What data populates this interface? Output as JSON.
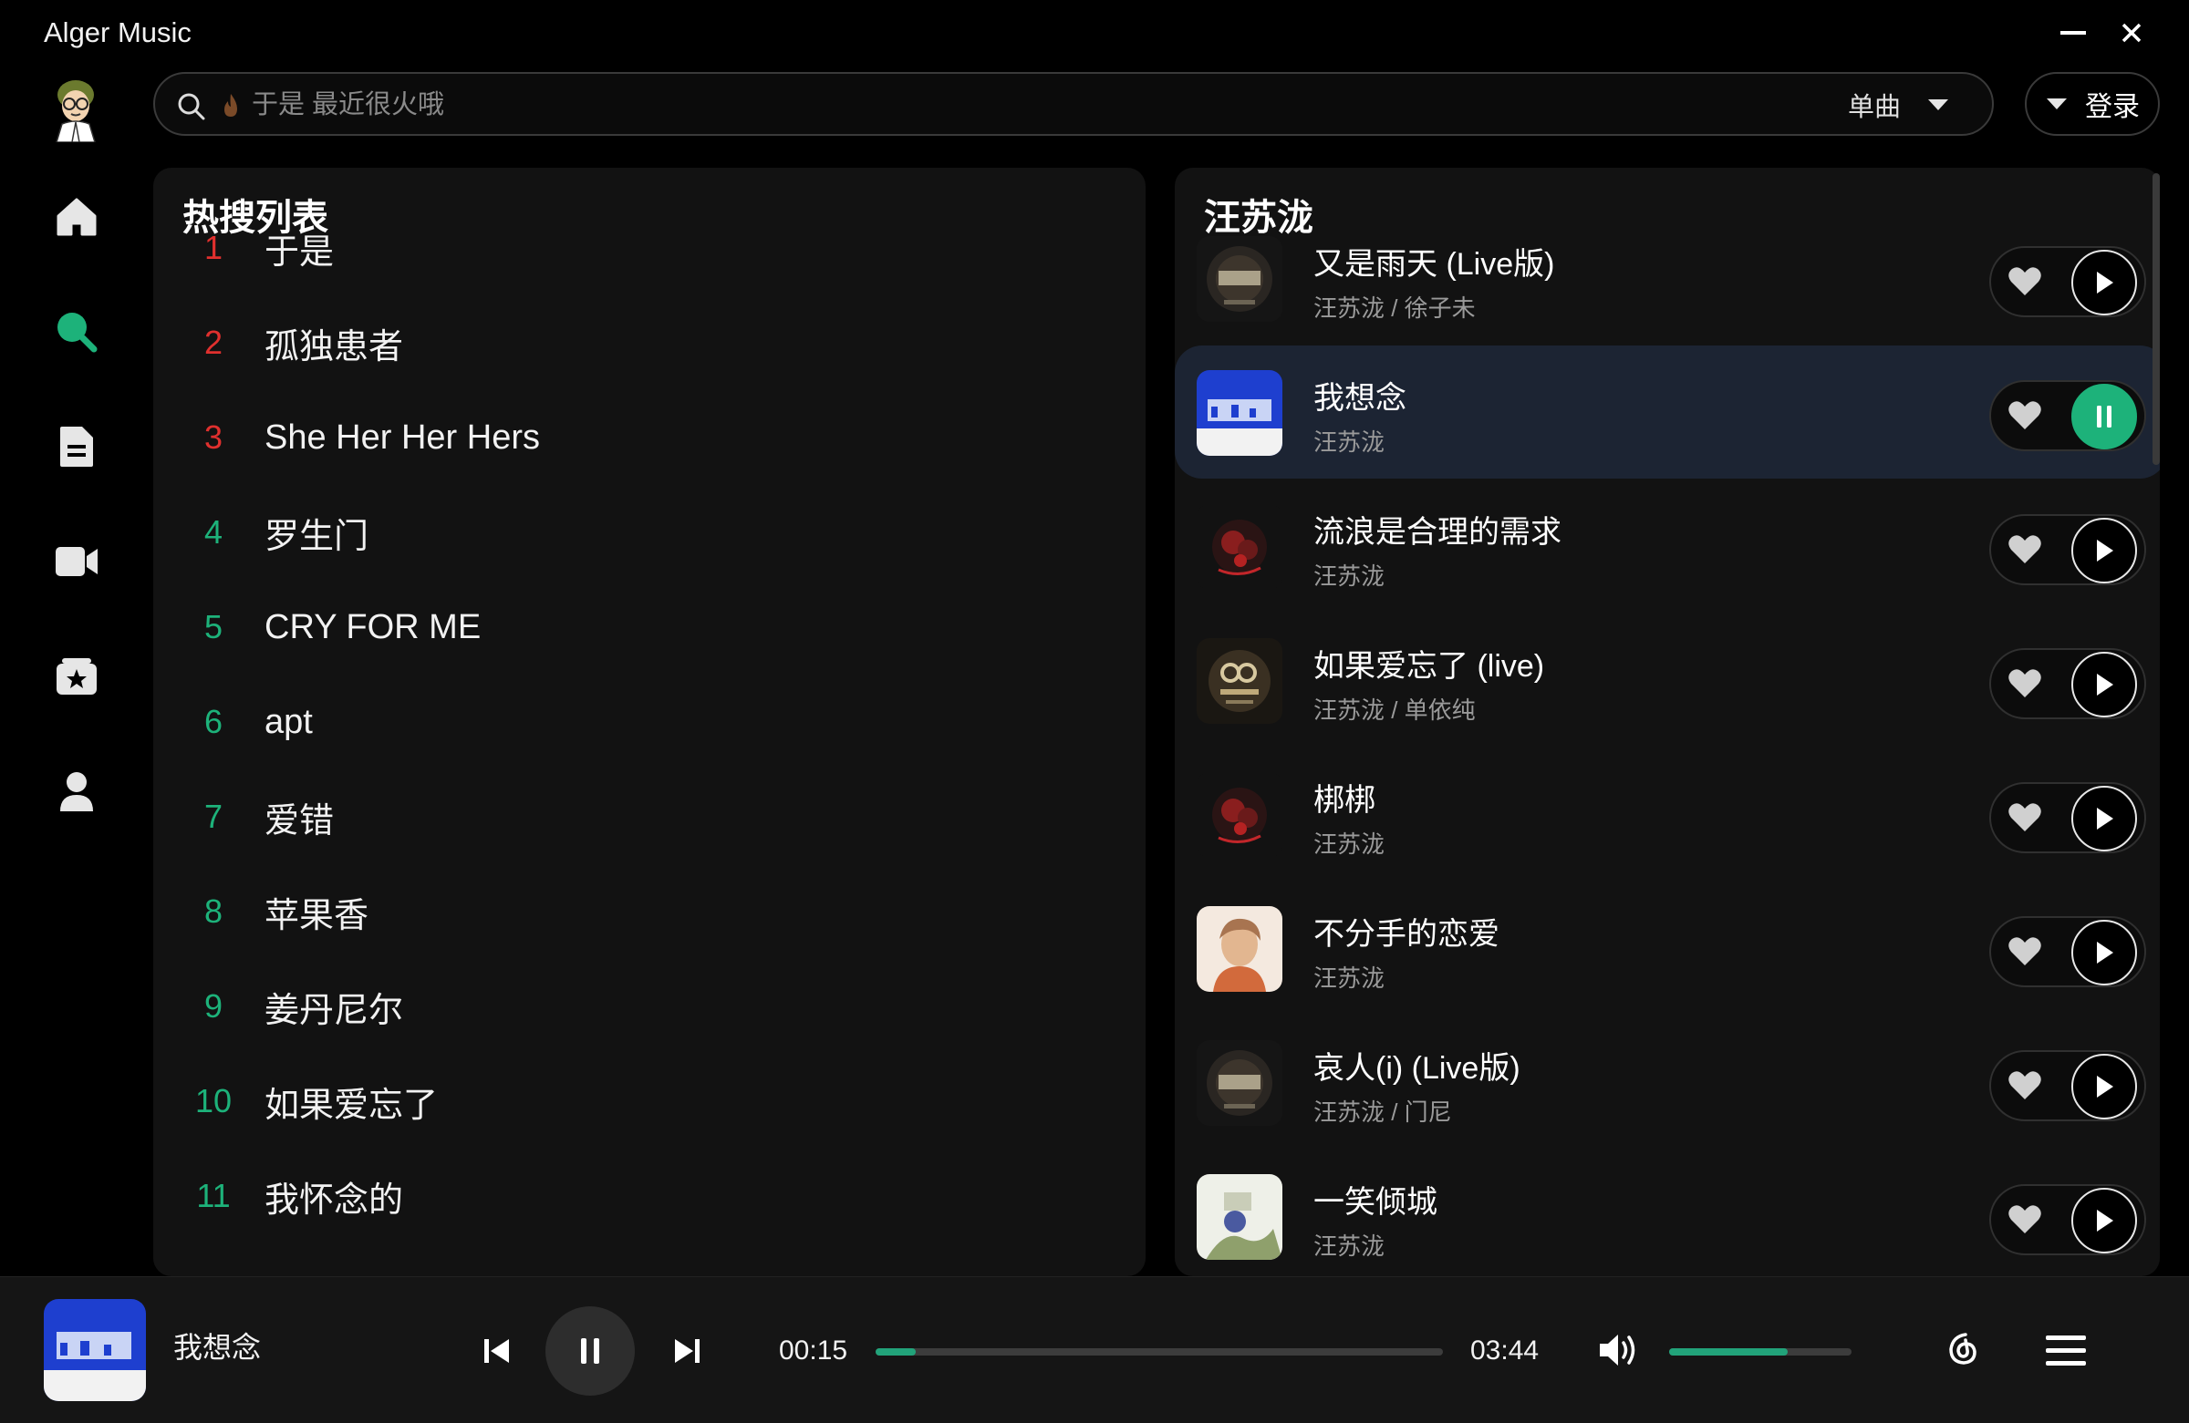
{
  "app": {
    "title": "Alger Music"
  },
  "colors": {
    "accent": "#1db27a",
    "rank_top": "#e0302e",
    "rank_other": "#1db27a",
    "active_row": "#1c2433"
  },
  "search": {
    "placeholder": "于是 最近很火哦",
    "value": "",
    "type_label": "单曲"
  },
  "login": {
    "label": "登录"
  },
  "sidebar": [
    "home-icon",
    "search-icon",
    "document-icon",
    "video-icon",
    "star-box-icon",
    "user-icon"
  ],
  "hot": {
    "title": "热搜列表",
    "items": [
      {
        "rank": "1",
        "text": "于是"
      },
      {
        "rank": "2",
        "text": "孤独患者"
      },
      {
        "rank": "3",
        "text": "She Her Her Hers"
      },
      {
        "rank": "4",
        "text": "罗生门"
      },
      {
        "rank": "5",
        "text": "CRY FOR ME"
      },
      {
        "rank": "6",
        "text": "apt"
      },
      {
        "rank": "7",
        "text": "爱错"
      },
      {
        "rank": "8",
        "text": "苹果香"
      },
      {
        "rank": "9",
        "text": "姜丹尼尔"
      },
      {
        "rank": "10",
        "text": "如果爱忘了"
      },
      {
        "rank": "11",
        "text": "我怀念的"
      }
    ]
  },
  "results": {
    "artist": "汪苏泷",
    "songs": [
      {
        "name": "又是雨天 (Live版)",
        "artists": "汪苏泷 / 徐子未",
        "state": "paused"
      },
      {
        "name": "我想念",
        "artists": "汪苏泷",
        "state": "playing"
      },
      {
        "name": "流浪是合理的需求",
        "artists": "汪苏泷",
        "state": "paused"
      },
      {
        "name": "如果爱忘了 (live)",
        "artists": "汪苏泷 / 单依纯",
        "state": "paused"
      },
      {
        "name": "梆梆",
        "artists": "汪苏泷",
        "state": "paused"
      },
      {
        "name": "不分手的恋爱",
        "artists": "汪苏泷",
        "state": "paused"
      },
      {
        "name": "哀人(i) (Live版)",
        "artists": "汪苏泷 / 门尼",
        "state": "paused"
      },
      {
        "name": "一笑倾城",
        "artists": "汪苏泷",
        "state": "paused"
      }
    ]
  },
  "player": {
    "song": "我想念",
    "current_time": "00:15",
    "total_time": "03:44",
    "progress_fraction": 0.07,
    "volume_fraction": 0.65
  }
}
